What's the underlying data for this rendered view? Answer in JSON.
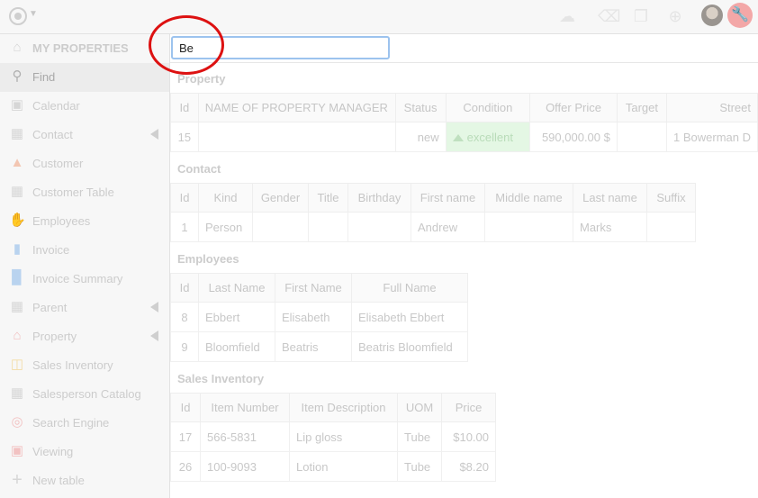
{
  "search": {
    "value": "Be"
  },
  "sidebar": {
    "items": [
      {
        "label": "MY PROPERTIES",
        "icon": "home-icon",
        "header": true
      },
      {
        "label": "Find",
        "icon": "search-icon",
        "active": true
      },
      {
        "label": "Calendar",
        "icon": "calendar-icon"
      },
      {
        "label": "Contact",
        "icon": "table-icon",
        "expandable": true
      },
      {
        "label": "Customer",
        "icon": "factory-icon"
      },
      {
        "label": "Customer Table",
        "icon": "table-icon"
      },
      {
        "label": "Employees",
        "icon": "handshake-icon"
      },
      {
        "label": "Invoice",
        "icon": "document-icon"
      },
      {
        "label": "Invoice Summary",
        "icon": "bar-chart-icon"
      },
      {
        "label": "Parent",
        "icon": "table-icon",
        "expandable": true
      },
      {
        "label": "Property",
        "icon": "house-icon",
        "expandable": true
      },
      {
        "label": "Sales Inventory",
        "icon": "forklift-icon"
      },
      {
        "label": "Salesperson Catalog",
        "icon": "table-icon"
      },
      {
        "label": "Search Engine",
        "icon": "target-icon"
      },
      {
        "label": "Viewing",
        "icon": "calendar-icon"
      },
      {
        "label": "New table",
        "icon": "plus-icon"
      }
    ]
  },
  "property": {
    "title": "Property",
    "headers": [
      "Id",
      "NAME OF PROPERTY MANAGER",
      "Status",
      "Condition",
      "Offer Price",
      "Target",
      "Street"
    ],
    "row": {
      "id": "15",
      "manager": "",
      "status": "new",
      "condition": "excellent",
      "offer_price": "590,000.00 $",
      "target": "",
      "street": "1 Bowerman D"
    }
  },
  "contact": {
    "title": "Contact",
    "headers": [
      "Id",
      "Kind",
      "Gender",
      "Title",
      "Birthday",
      "First name",
      "Middle name",
      "Last name",
      "Suffix"
    ],
    "rows": [
      [
        "1",
        "Person",
        "",
        "",
        "",
        "Andrew",
        "",
        "Marks",
        ""
      ]
    ]
  },
  "employees": {
    "title": "Employees",
    "headers": [
      "Id",
      "Last Name",
      "First Name",
      "Full Name"
    ],
    "rows": [
      [
        "8",
        "Ebbert",
        "Elisabeth",
        "Elisabeth Ebbert"
      ],
      [
        "9",
        "Bloomfield",
        "Beatris",
        "Beatris Bloomfield"
      ]
    ]
  },
  "sales_inventory": {
    "title": "Sales Inventory",
    "headers": [
      "Id",
      "Item Number",
      "Item Description",
      "UOM",
      "Price"
    ],
    "rows": [
      [
        "17",
        "566-5831",
        "Lip gloss",
        "Tube",
        "$10.00"
      ],
      [
        "26",
        "100-9093",
        "Lotion",
        "Tube",
        "$8.20"
      ]
    ]
  },
  "colors": {
    "accent_circle": "#dd1111",
    "wrench_bg": "#f3a7a7",
    "excellent_bg": "#e4f7e4"
  }
}
